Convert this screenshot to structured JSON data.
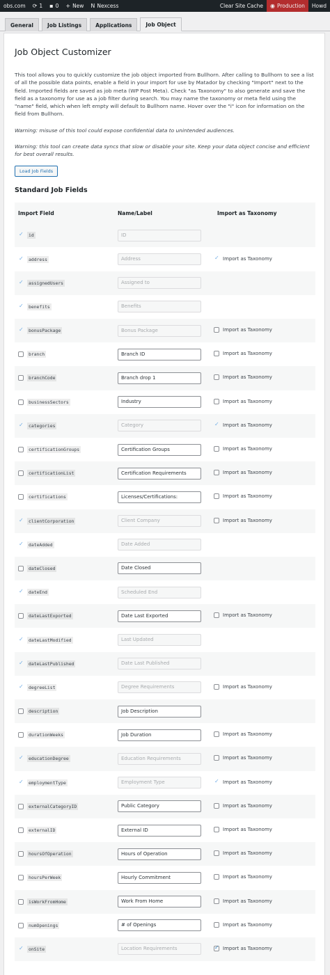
{
  "adminbar": {
    "site": "obs.com",
    "updates": "1",
    "comments": "0",
    "new": "New",
    "host": "Nexcess",
    "clear_cache": "Clear Site Cache",
    "environment": "Production",
    "howdy": "Howd"
  },
  "tabs": [
    "General",
    "Job Listings",
    "Applications",
    "Job Object"
  ],
  "page": {
    "title": "Job Object Customizer",
    "intro": "This tool allows you to quickly customize the job object imported from Bullhorn. After calling to Bullhorn to see a list of all the possible data points, enable a field in your import for use by Matador by checking \"Import\" next to the field. Imported fields are saved as job meta (WP Post Meta). Check \"as Taxonomy\" to also generate and save the field as a taxonomy for use as a job filter during search. You may name the taxonomy or meta field using the \"name\" field, which when left empty will default to Bullhorn name. Hover over the \"i\" icon for information on the field from Bullhorn.",
    "warning1": "Warning: misuse of this tool could expose confidential data to unintended audiences.",
    "warning2": "Warning: this tool can create data syncs that slow or disable your site. Keep your data object concise and efficient for best overall results.",
    "load_button": "Load Job Fields",
    "section_title": "Standard Job Fields"
  },
  "table": {
    "headers": [
      "Import Field",
      "Name/Label",
      "Import as Taxonomy"
    ],
    "tax_label": "Import as Taxonomy",
    "rows": [
      {
        "field": "id",
        "import": "locked",
        "label": "ID",
        "label_mode": "disabled",
        "tax": "none"
      },
      {
        "field": "address",
        "import": "locked",
        "label": "Address",
        "label_mode": "disabled",
        "tax": "locked"
      },
      {
        "field": "assignedUsers",
        "import": "locked",
        "label": "Assigned to",
        "label_mode": "disabled",
        "tax": "none"
      },
      {
        "field": "benefits",
        "import": "locked",
        "label": "Benefits",
        "label_mode": "disabled",
        "tax": "none"
      },
      {
        "field": "bonusPackage",
        "import": "locked",
        "label": "Bonus Package",
        "label_mode": "disabled",
        "tax": "off"
      },
      {
        "field": "branch",
        "import": "off",
        "label": "Branch ID",
        "label_mode": "active",
        "tax": "off"
      },
      {
        "field": "branchCode",
        "import": "off",
        "label": "Branch drop 1",
        "label_mode": "active",
        "tax": "off"
      },
      {
        "field": "businessSectors",
        "import": "off",
        "label": "Industry",
        "label_mode": "active",
        "tax": "off"
      },
      {
        "field": "categories",
        "import": "locked",
        "label": "Category",
        "label_mode": "disabled",
        "tax": "locked"
      },
      {
        "field": "certificationGroups",
        "import": "off",
        "label": "Certification Groups",
        "label_mode": "active",
        "tax": "off"
      },
      {
        "field": "certificationList",
        "import": "off",
        "label": "Certification Requirements",
        "label_mode": "active",
        "tax": "off"
      },
      {
        "field": "certifications",
        "import": "off",
        "label": "Licenses/Certifications:",
        "label_mode": "active",
        "tax": "off"
      },
      {
        "field": "clientCorporation",
        "import": "locked",
        "label": "Client Company",
        "label_mode": "disabled",
        "tax": "off"
      },
      {
        "field": "dateAdded",
        "import": "locked",
        "label": "Date Added",
        "label_mode": "disabled",
        "tax": "none"
      },
      {
        "field": "dateClosed",
        "import": "off",
        "label": "Date Closed",
        "label_mode": "active",
        "tax": "none"
      },
      {
        "field": "dateEnd",
        "import": "locked",
        "label": "Scheduled End",
        "label_mode": "disabled",
        "tax": "none"
      },
      {
        "field": "dateLastExported",
        "import": "off",
        "label": "Date Last Exported",
        "label_mode": "active",
        "tax": "off"
      },
      {
        "field": "dateLastModified",
        "import": "locked",
        "label": "Last Updated",
        "label_mode": "disabled",
        "tax": "none"
      },
      {
        "field": "dateLastPublished",
        "import": "locked",
        "label": "Date Last Published",
        "label_mode": "disabled",
        "tax": "none"
      },
      {
        "field": "degreeList",
        "import": "locked",
        "label": "Degree Requirements",
        "label_mode": "disabled",
        "tax": "off"
      },
      {
        "field": "description",
        "import": "off",
        "label": "Job Description",
        "label_mode": "active",
        "tax": "none"
      },
      {
        "field": "durationWeeks",
        "import": "off",
        "label": "Job Duration",
        "label_mode": "active",
        "tax": "off"
      },
      {
        "field": "educationDegree",
        "import": "locked",
        "label": "Education Requirements",
        "label_mode": "disabled",
        "tax": "off"
      },
      {
        "field": "employmentType",
        "import": "locked",
        "label": "Employment Type",
        "label_mode": "disabled",
        "tax": "locked"
      },
      {
        "field": "externalCategoryID",
        "import": "off",
        "label": "Public Category",
        "label_mode": "active",
        "tax": "off"
      },
      {
        "field": "externalID",
        "import": "off",
        "label": "External ID",
        "label_mode": "active",
        "tax": "off"
      },
      {
        "field": "hoursOfOperation",
        "import": "off",
        "label": "Hours of Operation",
        "label_mode": "active",
        "tax": "off"
      },
      {
        "field": "hoursPerWeek",
        "import": "off",
        "label": "Hourly Commitment",
        "label_mode": "active",
        "tax": "off"
      },
      {
        "field": "isWorkFromHome",
        "import": "off",
        "label": "Work From Home",
        "label_mode": "active",
        "tax": "off"
      },
      {
        "field": "numOpenings",
        "import": "off",
        "label": "# of Openings",
        "label_mode": "active",
        "tax": "off"
      },
      {
        "field": "onSite",
        "import": "locked",
        "label": "Location Requirements",
        "label_mode": "disabled",
        "tax": "on"
      }
    ]
  }
}
